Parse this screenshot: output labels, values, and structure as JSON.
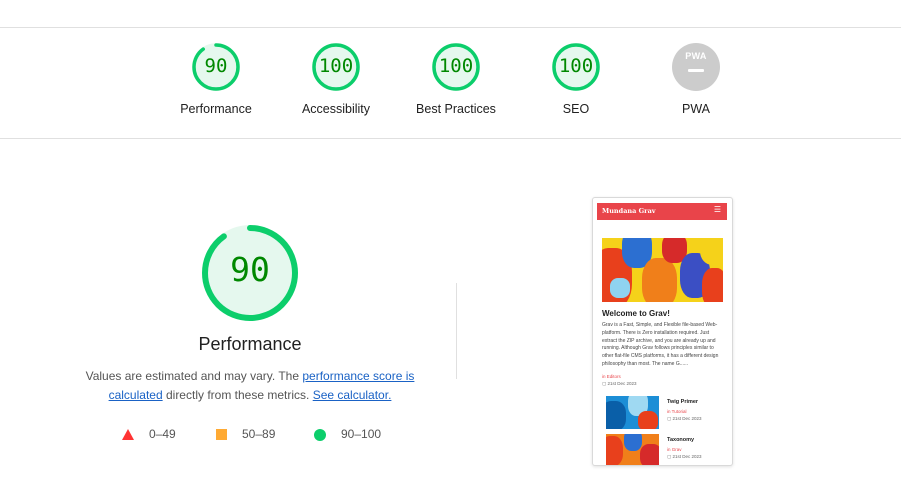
{
  "colors": {
    "pass": "#0cce6b",
    "pass_text": "#008800",
    "pass_fill": "#e5f8ee",
    "average": "#ffaa33",
    "fail": "#ff3333",
    "na": "#cccccc",
    "link": "#1a62c5"
  },
  "categories": [
    {
      "label": "Performance",
      "score": "90",
      "fraction": 0.9
    },
    {
      "label": "Accessibility",
      "score": "100",
      "fraction": 1.0
    },
    {
      "label": "Best Practices",
      "score": "100",
      "fraction": 1.0
    },
    {
      "label": "SEO",
      "score": "100",
      "fraction": 1.0
    },
    {
      "label": "PWA",
      "badge": "PWA",
      "score": null
    }
  ],
  "main": {
    "score": "90",
    "fraction": 0.9,
    "title": "Performance",
    "desc_prefix": "Values are estimated and may vary. The ",
    "desc_link": "performance score is calculated",
    "desc_middle": " directly from these metrics. ",
    "desc_link2": "See calculator.",
    "legend": [
      {
        "range": "0–49",
        "icon": "fail-triangle-icon"
      },
      {
        "range": "50–89",
        "icon": "average-square-icon"
      },
      {
        "range": "90–100",
        "icon": "pass-circle-icon"
      }
    ]
  },
  "preview": {
    "brand": "Mundana Grav",
    "menu_icon": "hamburger-icon",
    "heading": "Welcome to Grav!",
    "paragraph": "Grav is a Fast, Simple, and Flexible file-based Web-platform. There is Zero installation required. Just extract the ZIP archive, and you are already up and running. Although Grav follows principles similar to other flat-file CMS platforms, it has a different design philosophy than most. The name G......",
    "category": "in Editors",
    "date": "21st Dec 2023",
    "cards": [
      {
        "title": "Twig Primer",
        "category": "in Tutorial",
        "date": "21st Dec 2023"
      },
      {
        "title": "Taxonomy",
        "category": "in Grav",
        "date": "21st Dec 2023"
      }
    ]
  }
}
